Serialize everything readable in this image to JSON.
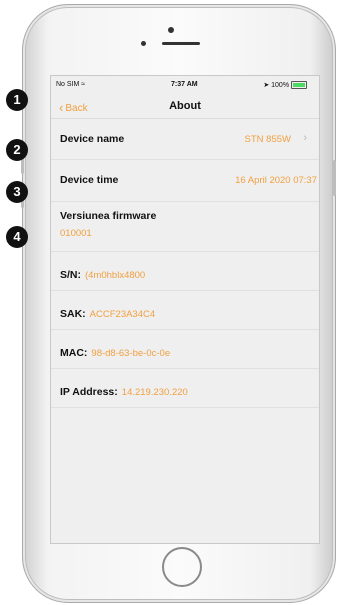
{
  "status_bar": {
    "carrier": "No SIM",
    "time": "7:37 AM",
    "battery": "100%",
    "battery_level": 1.0
  },
  "nav": {
    "back_label": "Back",
    "title": "About"
  },
  "rows": {
    "device_name": {
      "label": "Device name",
      "value": "STN 855W"
    },
    "device_time": {
      "label": "Device time",
      "value": "16 April 2020 07:37"
    },
    "firmware": {
      "label": "Versiunea firmware",
      "value": "010001"
    },
    "serial": {
      "label": "S/N:",
      "value": "(4m0hblx4800"
    },
    "sak": {
      "label": "SAK:",
      "value": "ACCF23A34C4"
    },
    "mac": {
      "label": "MAC:",
      "value": "98-d8-63-be-0c-0e"
    },
    "ip": {
      "label": "IP Address:",
      "value": "14.219.230.220"
    }
  },
  "callouts": [
    "1",
    "2",
    "3",
    "4"
  ],
  "icons": {
    "back": "chevron-left-icon",
    "disclosure": "chevron-right-icon",
    "wifi": "wifi-icon",
    "location": "location-arrow-icon",
    "battery": "battery-icon"
  },
  "colors": {
    "accent": "#f0a040",
    "text": "#111111"
  }
}
